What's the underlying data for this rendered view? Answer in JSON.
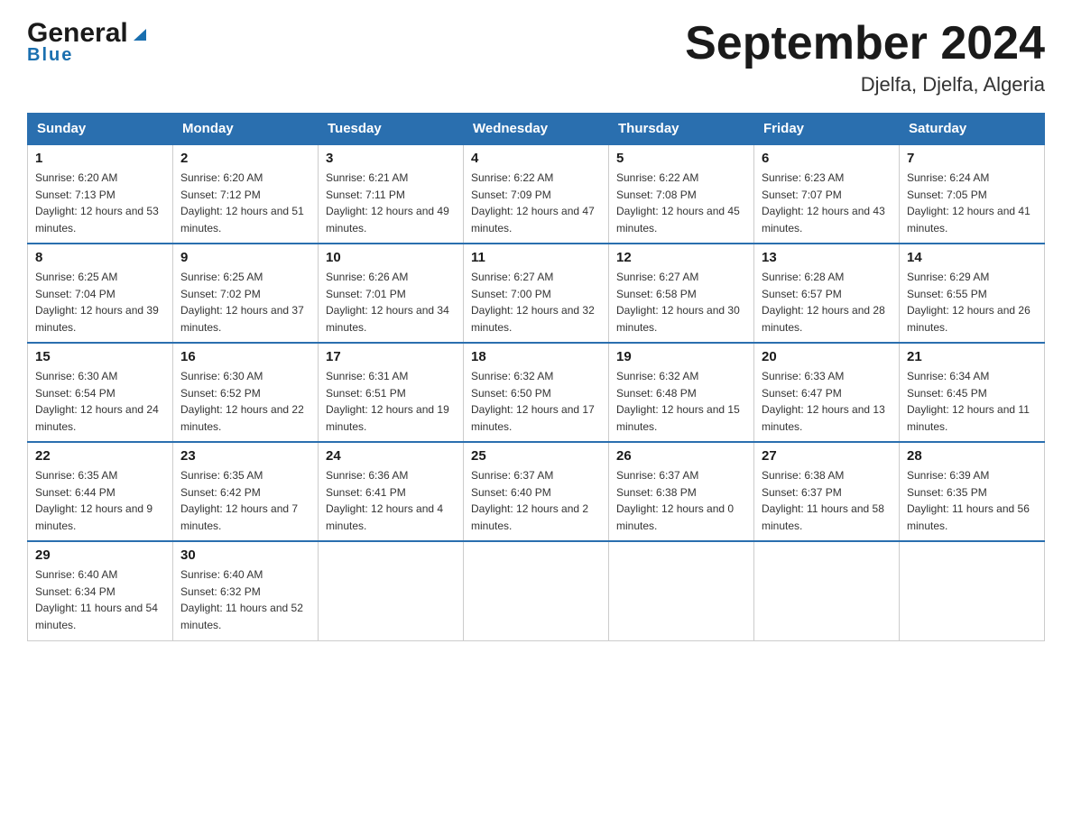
{
  "header": {
    "logo_general": "General",
    "logo_blue": "Blue",
    "title": "September 2024",
    "subtitle": "Djelfa, Djelfa, Algeria"
  },
  "days_of_week": [
    "Sunday",
    "Monday",
    "Tuesday",
    "Wednesday",
    "Thursday",
    "Friday",
    "Saturday"
  ],
  "weeks": [
    [
      {
        "day": "1",
        "sunrise": "6:20 AM",
        "sunset": "7:13 PM",
        "daylight": "12 hours and 53 minutes."
      },
      {
        "day": "2",
        "sunrise": "6:20 AM",
        "sunset": "7:12 PM",
        "daylight": "12 hours and 51 minutes."
      },
      {
        "day": "3",
        "sunrise": "6:21 AM",
        "sunset": "7:11 PM",
        "daylight": "12 hours and 49 minutes."
      },
      {
        "day": "4",
        "sunrise": "6:22 AM",
        "sunset": "7:09 PM",
        "daylight": "12 hours and 47 minutes."
      },
      {
        "day": "5",
        "sunrise": "6:22 AM",
        "sunset": "7:08 PM",
        "daylight": "12 hours and 45 minutes."
      },
      {
        "day": "6",
        "sunrise": "6:23 AM",
        "sunset": "7:07 PM",
        "daylight": "12 hours and 43 minutes."
      },
      {
        "day": "7",
        "sunrise": "6:24 AM",
        "sunset": "7:05 PM",
        "daylight": "12 hours and 41 minutes."
      }
    ],
    [
      {
        "day": "8",
        "sunrise": "6:25 AM",
        "sunset": "7:04 PM",
        "daylight": "12 hours and 39 minutes."
      },
      {
        "day": "9",
        "sunrise": "6:25 AM",
        "sunset": "7:02 PM",
        "daylight": "12 hours and 37 minutes."
      },
      {
        "day": "10",
        "sunrise": "6:26 AM",
        "sunset": "7:01 PM",
        "daylight": "12 hours and 34 minutes."
      },
      {
        "day": "11",
        "sunrise": "6:27 AM",
        "sunset": "7:00 PM",
        "daylight": "12 hours and 32 minutes."
      },
      {
        "day": "12",
        "sunrise": "6:27 AM",
        "sunset": "6:58 PM",
        "daylight": "12 hours and 30 minutes."
      },
      {
        "day": "13",
        "sunrise": "6:28 AM",
        "sunset": "6:57 PM",
        "daylight": "12 hours and 28 minutes."
      },
      {
        "day": "14",
        "sunrise": "6:29 AM",
        "sunset": "6:55 PM",
        "daylight": "12 hours and 26 minutes."
      }
    ],
    [
      {
        "day": "15",
        "sunrise": "6:30 AM",
        "sunset": "6:54 PM",
        "daylight": "12 hours and 24 minutes."
      },
      {
        "day": "16",
        "sunrise": "6:30 AM",
        "sunset": "6:52 PM",
        "daylight": "12 hours and 22 minutes."
      },
      {
        "day": "17",
        "sunrise": "6:31 AM",
        "sunset": "6:51 PM",
        "daylight": "12 hours and 19 minutes."
      },
      {
        "day": "18",
        "sunrise": "6:32 AM",
        "sunset": "6:50 PM",
        "daylight": "12 hours and 17 minutes."
      },
      {
        "day": "19",
        "sunrise": "6:32 AM",
        "sunset": "6:48 PM",
        "daylight": "12 hours and 15 minutes."
      },
      {
        "day": "20",
        "sunrise": "6:33 AM",
        "sunset": "6:47 PM",
        "daylight": "12 hours and 13 minutes."
      },
      {
        "day": "21",
        "sunrise": "6:34 AM",
        "sunset": "6:45 PM",
        "daylight": "12 hours and 11 minutes."
      }
    ],
    [
      {
        "day": "22",
        "sunrise": "6:35 AM",
        "sunset": "6:44 PM",
        "daylight": "12 hours and 9 minutes."
      },
      {
        "day": "23",
        "sunrise": "6:35 AM",
        "sunset": "6:42 PM",
        "daylight": "12 hours and 7 minutes."
      },
      {
        "day": "24",
        "sunrise": "6:36 AM",
        "sunset": "6:41 PM",
        "daylight": "12 hours and 4 minutes."
      },
      {
        "day": "25",
        "sunrise": "6:37 AM",
        "sunset": "6:40 PM",
        "daylight": "12 hours and 2 minutes."
      },
      {
        "day": "26",
        "sunrise": "6:37 AM",
        "sunset": "6:38 PM",
        "daylight": "12 hours and 0 minutes."
      },
      {
        "day": "27",
        "sunrise": "6:38 AM",
        "sunset": "6:37 PM",
        "daylight": "11 hours and 58 minutes."
      },
      {
        "day": "28",
        "sunrise": "6:39 AM",
        "sunset": "6:35 PM",
        "daylight": "11 hours and 56 minutes."
      }
    ],
    [
      {
        "day": "29",
        "sunrise": "6:40 AM",
        "sunset": "6:34 PM",
        "daylight": "11 hours and 54 minutes."
      },
      {
        "day": "30",
        "sunrise": "6:40 AM",
        "sunset": "6:32 PM",
        "daylight": "11 hours and 52 minutes."
      },
      null,
      null,
      null,
      null,
      null
    ]
  ],
  "labels": {
    "sunrise": "Sunrise:",
    "sunset": "Sunset:",
    "daylight": "Daylight:"
  }
}
